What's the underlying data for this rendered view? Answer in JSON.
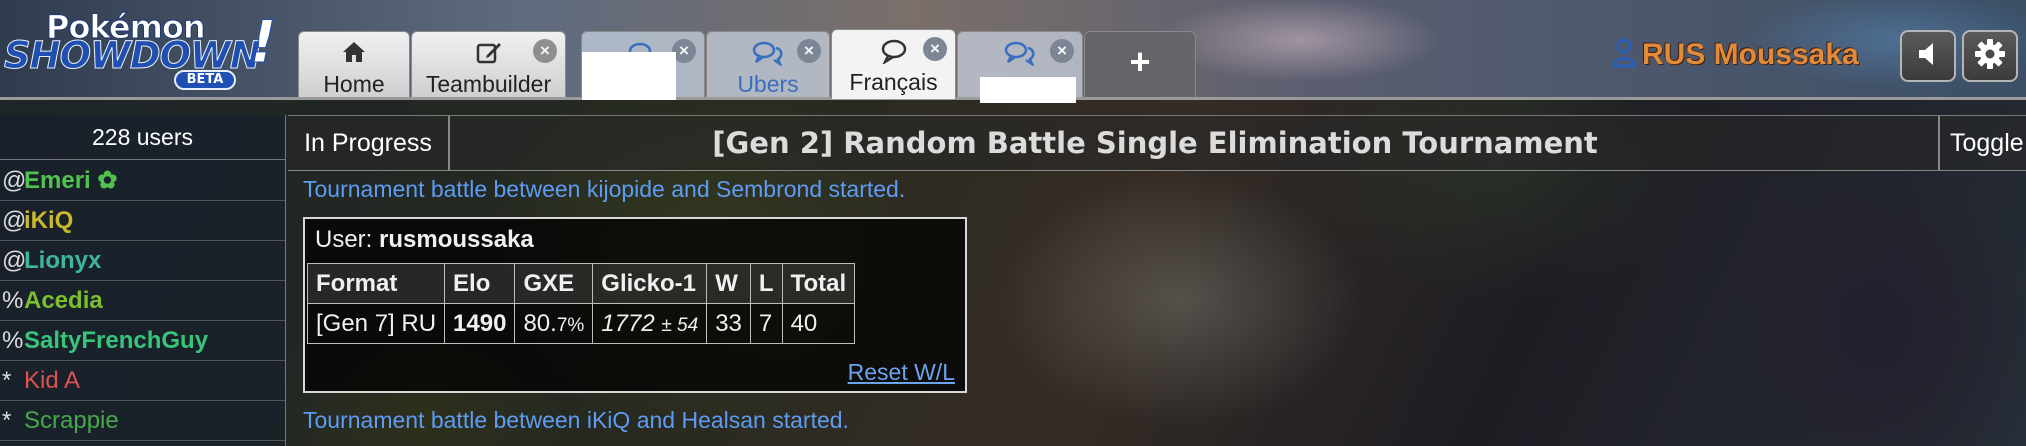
{
  "header": {
    "logo": {
      "line1": "Pokémon",
      "line2": "SHOWDOWN",
      "bang": "!",
      "badge": "BETA"
    },
    "tabs": [
      {
        "label": "Home",
        "icon": "home-icon",
        "closable": false
      },
      {
        "label": "Teambuilder",
        "icon": "edit-icon",
        "closable": true
      },
      {
        "label": "",
        "icon": "chat-bubbles-icon",
        "closable": true,
        "redacted": true
      },
      {
        "label": "Ubers",
        "icon": "chat-bubbles-icon",
        "closable": true
      },
      {
        "label": "Français",
        "icon": "chat-bubble-icon",
        "closable": true,
        "active": true
      },
      {
        "label": "",
        "icon": "chat-bubbles-icon",
        "closable": true,
        "redacted": true
      },
      {
        "label": "+",
        "icon": "plus-icon",
        "closable": false
      }
    ],
    "close_glyph": "×",
    "user": {
      "name": "RUS Moussaka",
      "color": "#e08a3a"
    },
    "buttons": {
      "sound": "volume-icon",
      "settings": "gear-icon"
    }
  },
  "userlist": {
    "count_text": "228 users",
    "users": [
      {
        "rank": "@",
        "name": "Emeri ✿",
        "color": "#52c24f",
        "bold": true
      },
      {
        "rank": "@",
        "name": "iKiQ",
        "color": "#c9b82c",
        "bold": true
      },
      {
        "rank": "@",
        "name": "Lionyx",
        "color": "#3fb59a",
        "bold": true
      },
      {
        "rank": "%",
        "name": "Acedia",
        "color": "#7cbf2f",
        "bold": true
      },
      {
        "rank": "%",
        "name": "SaltyFrenchGuy",
        "color": "#38c47a",
        "bold": true
      },
      {
        "rank": "*",
        "name": "Kid A",
        "color": "#e0524d",
        "bold": false
      },
      {
        "rank": "*",
        "name": "Scrappie",
        "color": "#46a84a",
        "bold": false
      }
    ]
  },
  "roombar": {
    "status": "In Progress",
    "title": "[Gen 2] Random Battle Single Elimination Tournament",
    "toggle": "Toggle"
  },
  "chat": {
    "line1": "Tournament battle between kijopide and Sembrond started.",
    "line2": "Tournament battle between iKiQ and Healsan started.",
    "link_color": "#5d9cf2"
  },
  "rankbox": {
    "user_label": "User:",
    "user_name": "rusmoussaka",
    "columns": [
      "Format",
      "Elo",
      "GXE",
      "Glicko-1",
      "W",
      "L",
      "Total"
    ],
    "row": {
      "format": "[Gen 7] RU",
      "elo": "1490",
      "gxe_main": "80.",
      "gxe_decimal": "7%",
      "glicko_main": "1772",
      "glicko_dev": "± 54",
      "w": "33",
      "l": "7",
      "total": "40"
    },
    "reset_link": "Reset W/L"
  }
}
